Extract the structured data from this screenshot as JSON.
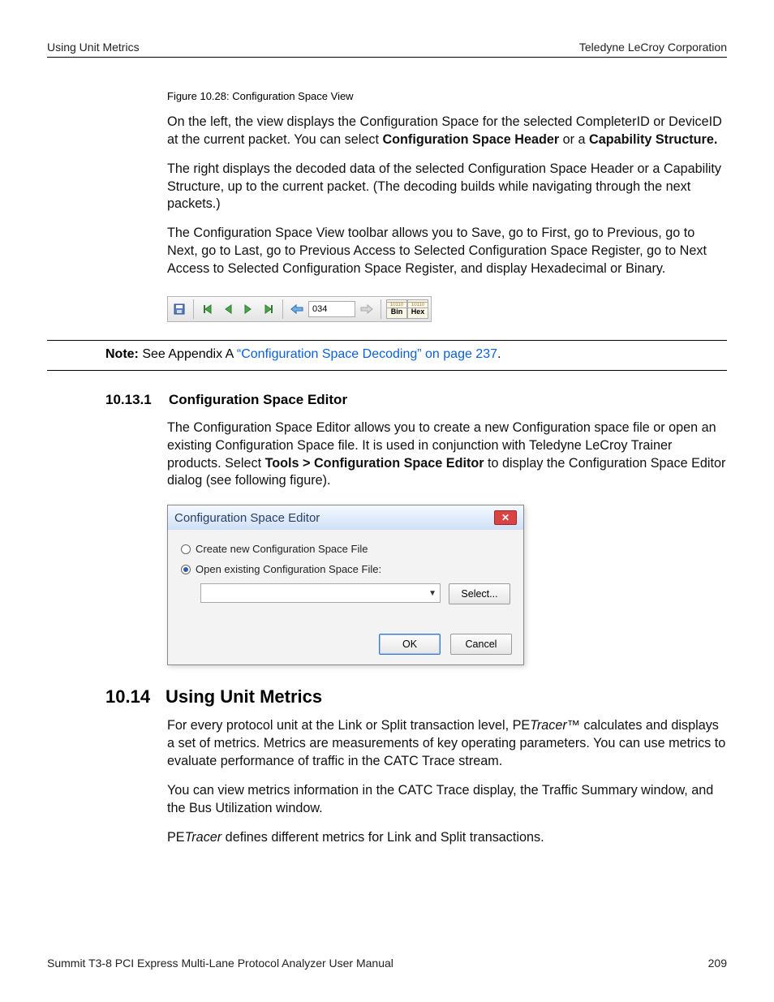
{
  "header": {
    "left": "Using Unit Metrics",
    "right": "Teledyne LeCroy Corporation"
  },
  "figcaption": "Figure 10.28:  Configuration Space View",
  "p1_a": "On the left, the view displays the Configuration Space for the selected CompleterID or DeviceID at the current packet. You can select ",
  "p1_b": "Configuration Space Header",
  "p1_c": " or a ",
  "p1_d": "Capability Structure.",
  "p2": "The right displays the decoded data of the selected Configuration Space Header or a Capability Structure, up to the current packet. (The decoding builds while navigating through the next packets.)",
  "p3_a": "The Configuration Space View toolbar allows you to ",
  "p3_b": "Save",
  "p3_c": ", go to First, go to Previous, go to Next, go to Last, go to Previous Access to Selected Configuration Space Register, go to Next Access to Selected Configuration Space Register, and display Hexadecimal or Binary.",
  "toolbar": {
    "field_value": "034",
    "bin_label": "Bin",
    "hex_label": "Hex",
    "tiny": "10110"
  },
  "note": {
    "label": "Note:",
    "text_a": " See Appendix A ",
    "link": "“Configuration Space Decoding” on page 237",
    "text_b": "."
  },
  "sub1": {
    "num": "10.13.1",
    "title": "Configuration Space Editor"
  },
  "p4_a": "The Configuration Space Editor allows you to create a new Configuration space file or open an existing Configuration Space file. It is used in conjunction with Teledyne LeCroy Trainer products. Select ",
  "p4_b": "Tools > Configuration Space Editor",
  "p4_c": " to display the Configuration Space Editor dialog (see following figure).",
  "dialog": {
    "title": "Configuration Space Editor",
    "opt_create": "Create new Configuration Space File",
    "opt_open": "Open existing Configuration Space File:",
    "select_btn": "Select...",
    "ok": "OK",
    "cancel": "Cancel",
    "selected": "open"
  },
  "h2": {
    "num": "10.14",
    "title": "Using Unit Metrics"
  },
  "p5_a": "For every protocol unit at the Link or Split transaction level, PE",
  "p5_b": "Tracer",
  "p5_c": "™ calculates and displays a set of metrics. Metrics are measurements of key operating parameters. You can use metrics to evaluate performance of traffic in the CATC Trace stream.",
  "p6": "You can view metrics information in the CATC Trace display, the Traffic Summary window, and the Bus Utilization window.",
  "p7_a": "PE",
  "p7_b": "Tracer",
  "p7_c": " defines different metrics for Link and Split transactions.",
  "footer": {
    "left": "Summit T3-8 PCI Express Multi-Lane Protocol Analyzer User Manual",
    "right": "209"
  }
}
